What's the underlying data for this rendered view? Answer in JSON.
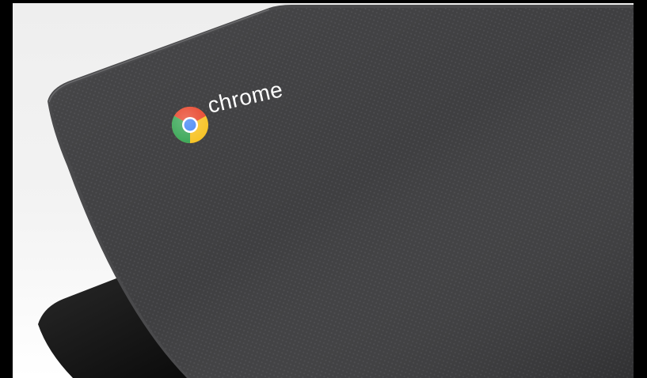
{
  "photo": {
    "subject": "Chromebook lid",
    "logo": {
      "icon": "chrome-logo-icon",
      "wordmark": "chrome",
      "colors": {
        "red": "#e8452c",
        "yellow": "#f7c325",
        "green": "#3aa757",
        "blue": "#4285f4"
      }
    },
    "colors": {
      "background": "#f0f0f0",
      "lid": "#3a3a3c",
      "lid_edge": "#5a5a5c",
      "screen": "#0c0c0c",
      "border": "#000000"
    }
  }
}
